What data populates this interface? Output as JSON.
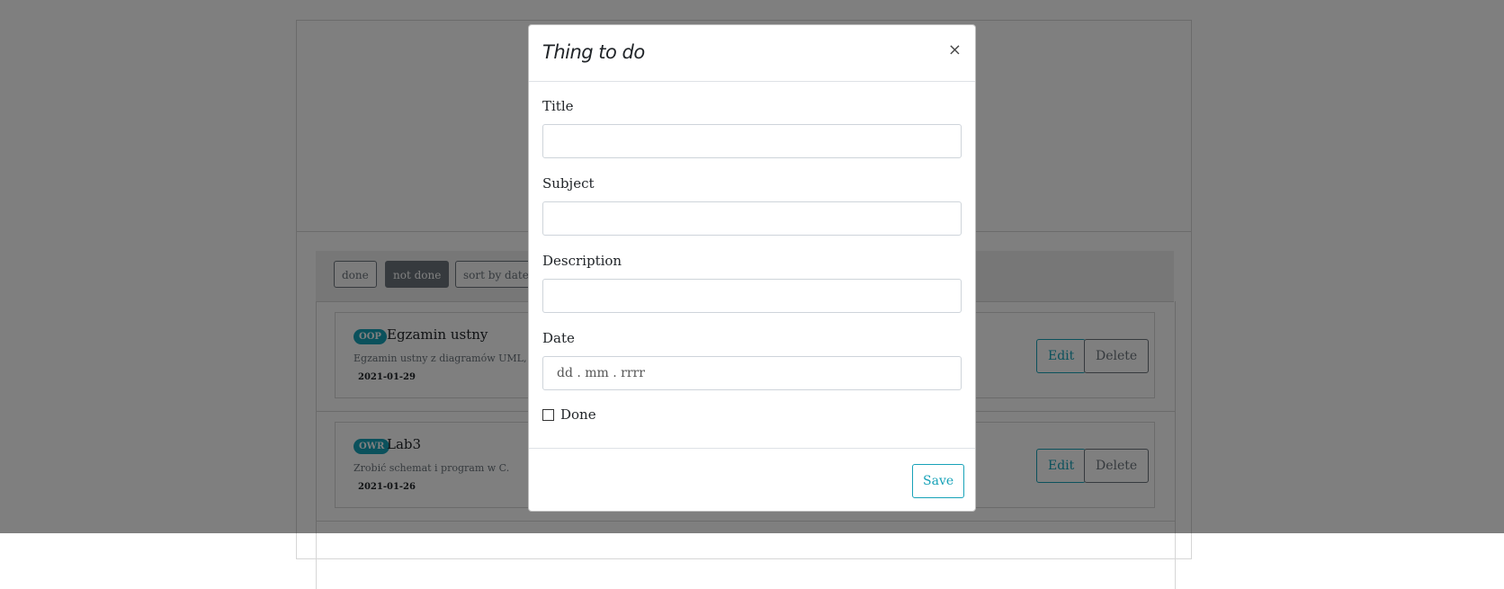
{
  "filters": {
    "done": "done",
    "not_done": "not done",
    "sort": "sort by date ↑"
  },
  "items": [
    {
      "badge": "OOP",
      "title": "Egzamin ustny",
      "description": "Egzamin ustny z diagramów UML, Design Patterns",
      "date": "2021-01-29",
      "edit": "Edit",
      "delete": "Delete"
    },
    {
      "badge": "OWR",
      "title": "Lab3",
      "description": "Zrobić schemat i program w C.",
      "date": "2021-01-26",
      "edit": "Edit",
      "delete": "Delete"
    }
  ],
  "modal": {
    "title": "Thing to do",
    "close_icon": "×",
    "fields": {
      "title_label": "Title",
      "subject_label": "Subject",
      "description_label": "Description",
      "date_label": "Date",
      "date_placeholder": "dd . mm . rrrr",
      "done_label": "Done"
    },
    "save_label": "Save"
  },
  "colors": {
    "accent": "#17a2b8",
    "secondary": "#6c757d"
  }
}
